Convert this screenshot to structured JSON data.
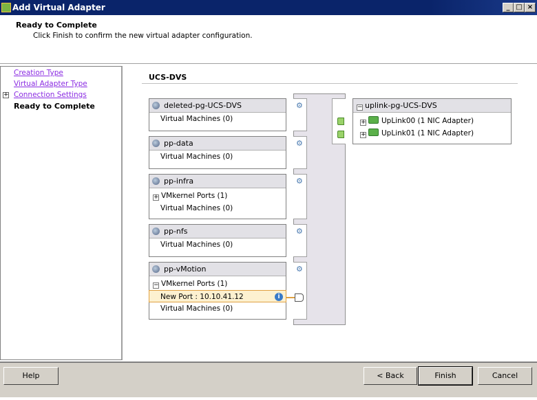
{
  "window": {
    "title": "Add Virtual Adapter",
    "controls": {
      "minimize": "_",
      "maximize": "□",
      "close": "×"
    }
  },
  "header": {
    "title": "Ready to Complete",
    "subtitle": "Click Finish to confirm the new virtual adapter configuration."
  },
  "steps": [
    {
      "label": "Creation Type",
      "link": true
    },
    {
      "label": "Virtual Adapter Type",
      "link": true
    },
    {
      "label": "Connection Settings",
      "link": true,
      "expander": "+"
    },
    {
      "label": "Ready to Complete",
      "current": true
    }
  ],
  "switch": {
    "name": "UCS-DVS"
  },
  "port_groups": [
    {
      "name": "deleted-pg-UCS-DVS",
      "vms": "Virtual Machines (0)"
    },
    {
      "name": "pp-data",
      "vms": "Virtual Machines (0)"
    },
    {
      "name": "pp-infra",
      "vmk": "VMkernel Ports (1)",
      "vmk_expander": "+",
      "vms": "Virtual Machines (0)"
    },
    {
      "name": "pp-nfs",
      "vms": "Virtual Machines (0)"
    },
    {
      "name": "pp-vMotion",
      "vmk": "VMkernel Ports (1)",
      "vmk_expander": "−",
      "new_port": "New Port : 10.10.41.12",
      "vms": "Virtual Machines (0)"
    }
  ],
  "uplink_group": {
    "name": "uplink-pg-UCS-DVS",
    "expander": "−",
    "uplinks": [
      {
        "label": "UpLink00 (1 NIC Adapter)",
        "expander": "+"
      },
      {
        "label": "UpLink01 (1 NIC Adapter)",
        "expander": "+"
      }
    ]
  },
  "buttons": {
    "help": "Help",
    "back": "< Back",
    "finish": "Finish",
    "cancel": "Cancel"
  },
  "colors": {
    "titlebar": "#0a246a",
    "link": "#8a2be2",
    "selection": "#fdf1d0",
    "footer": "#d4d0c8"
  }
}
